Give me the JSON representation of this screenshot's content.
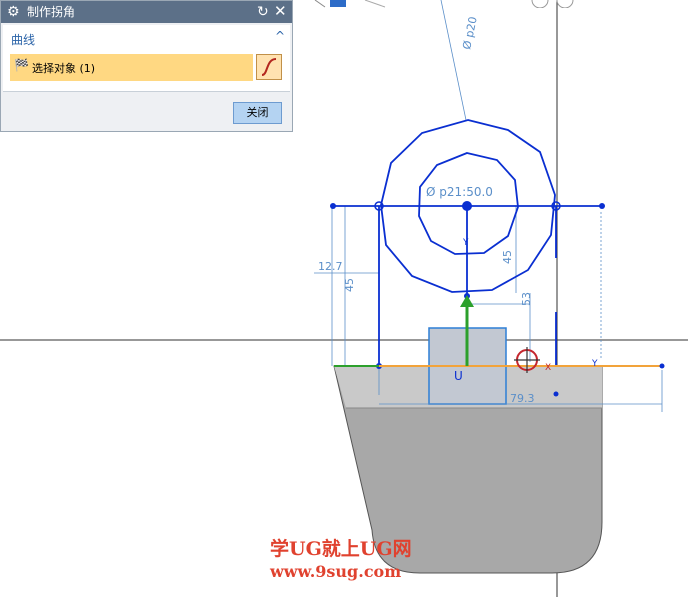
{
  "dialog": {
    "title": "制作拐角",
    "section_label": "曲线",
    "section_toggle": "^",
    "select_label": "选择对象 (1)",
    "close_button": "关闭",
    "icons": {
      "title": "gear-icon",
      "reset": "reset-icon",
      "close": "close-icon",
      "flag": "flag-icon",
      "curve": "curve-select-icon"
    }
  },
  "dimensions": {
    "phi_top": "Ø p20",
    "phi_center": "Ø p21:50.0",
    "d_12_7": "12.7",
    "d_45_left": "45",
    "d_45_right": "45",
    "d_53": "53",
    "d_79_3": "79.3"
  },
  "markers": {
    "u_label": "U",
    "x_label": "X",
    "y_label": "Y"
  },
  "watermark": {
    "line1": "学UG就上UG网",
    "line2": "www.9sug.com"
  },
  "colors": {
    "sketch_blue": "#0a2fd1",
    "dimension_blue": "#5b8fc9",
    "solid_gray": "#a8a8a8",
    "highlight_orange": "#f2a33a",
    "titlebar": "#5c7088",
    "selection_yellow": "#ffd882",
    "watermark_red": "#e0422f"
  }
}
